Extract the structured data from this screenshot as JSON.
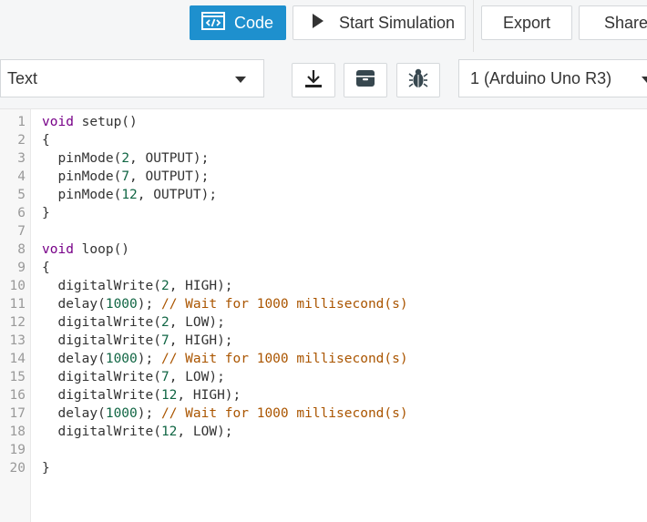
{
  "header": {
    "code_label": "Code",
    "simulate_label": "Start Simulation",
    "export_label": "Export",
    "share_label": "Share"
  },
  "toolbar": {
    "mode_value": "Text",
    "board_value": "1 (Arduino Uno R3)",
    "download_icon": "download-icon",
    "library_icon": "library-icon",
    "debug_icon": "bug-icon"
  },
  "editor": {
    "lines": [
      {
        "n": "1",
        "t": [
          {
            "c": "kw",
            "s": "void"
          },
          {
            "s": " setup()"
          }
        ]
      },
      {
        "n": "2",
        "t": [
          {
            "s": "{"
          }
        ]
      },
      {
        "n": "3",
        "t": [
          {
            "s": "  pinMode("
          },
          {
            "c": "num",
            "s": "2"
          },
          {
            "s": ", OUTPUT);"
          }
        ]
      },
      {
        "n": "4",
        "t": [
          {
            "s": "  pinMode("
          },
          {
            "c": "num",
            "s": "7"
          },
          {
            "s": ", OUTPUT);"
          }
        ]
      },
      {
        "n": "5",
        "t": [
          {
            "s": "  pinMode("
          },
          {
            "c": "num",
            "s": "12"
          },
          {
            "s": ", OUTPUT);"
          }
        ]
      },
      {
        "n": "6",
        "t": [
          {
            "s": "}"
          }
        ]
      },
      {
        "n": "7",
        "t": []
      },
      {
        "n": "8",
        "t": [
          {
            "c": "kw",
            "s": "void"
          },
          {
            "s": " loop()"
          }
        ]
      },
      {
        "n": "9",
        "t": [
          {
            "s": "{"
          }
        ]
      },
      {
        "n": "10",
        "t": [
          {
            "s": "  digitalWrite("
          },
          {
            "c": "num",
            "s": "2"
          },
          {
            "s": ", HIGH);"
          }
        ]
      },
      {
        "n": "11",
        "t": [
          {
            "s": "  delay("
          },
          {
            "c": "num",
            "s": "1000"
          },
          {
            "s": "); "
          },
          {
            "c": "cm",
            "s": "// Wait for 1000 millisecond(s)"
          }
        ]
      },
      {
        "n": "12",
        "t": [
          {
            "s": "  digitalWrite("
          },
          {
            "c": "num",
            "s": "2"
          },
          {
            "s": ", LOW);"
          }
        ]
      },
      {
        "n": "13",
        "t": [
          {
            "s": "  digitalWrite("
          },
          {
            "c": "num",
            "s": "7"
          },
          {
            "s": ", HIGH);"
          }
        ]
      },
      {
        "n": "14",
        "t": [
          {
            "s": "  delay("
          },
          {
            "c": "num",
            "s": "1000"
          },
          {
            "s": "); "
          },
          {
            "c": "cm",
            "s": "// Wait for 1000 millisecond(s)"
          }
        ]
      },
      {
        "n": "15",
        "t": [
          {
            "s": "  digitalWrite("
          },
          {
            "c": "num",
            "s": "7"
          },
          {
            "s": ", LOW);"
          }
        ]
      },
      {
        "n": "16",
        "t": [
          {
            "s": "  digitalWrite("
          },
          {
            "c": "num",
            "s": "12"
          },
          {
            "s": ", HIGH);"
          }
        ]
      },
      {
        "n": "17",
        "t": [
          {
            "s": "  delay("
          },
          {
            "c": "num",
            "s": "1000"
          },
          {
            "s": "); "
          },
          {
            "c": "cm",
            "s": "// Wait for 1000 millisecond(s)"
          }
        ]
      },
      {
        "n": "18",
        "t": [
          {
            "s": "  digitalWrite("
          },
          {
            "c": "num",
            "s": "12"
          },
          {
            "s": ", LOW);"
          }
        ]
      },
      {
        "n": "19",
        "t": []
      },
      {
        "n": "20",
        "t": [
          {
            "s": "}"
          }
        ]
      }
    ]
  },
  "colors": {
    "accent": "#1e90ce",
    "keyword": "#770088",
    "number": "#116644",
    "comment": "#aa5500"
  }
}
